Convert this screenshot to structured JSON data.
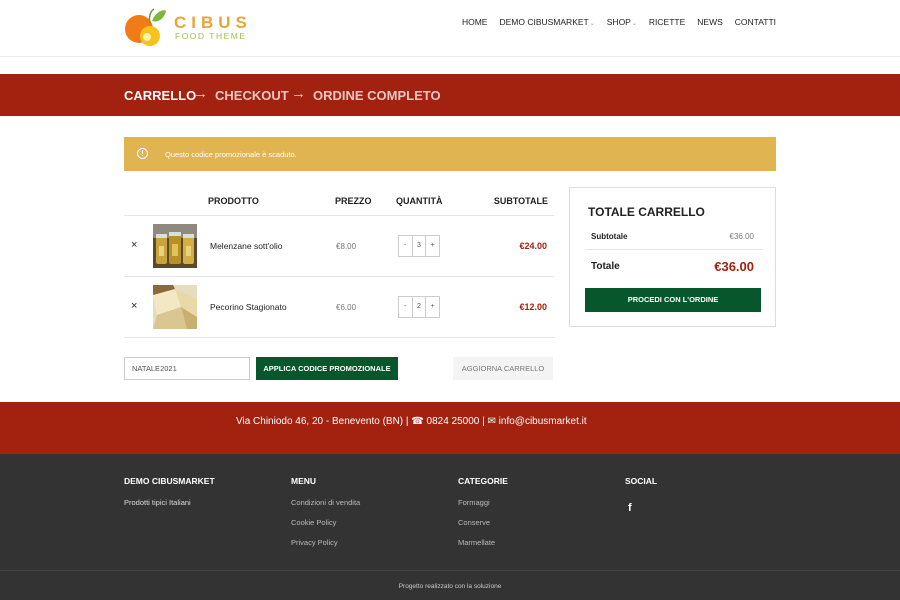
{
  "header": {
    "logo_text": "CIBUS",
    "logo_sub": "FOOD THEME",
    "nav": [
      {
        "label": "HOME"
      },
      {
        "label": "DEMO CIBUSMARKET",
        "has_caret": true
      },
      {
        "label": "SHOP",
        "has_caret": true
      },
      {
        "label": "RICETTE"
      },
      {
        "label": "NEWS"
      },
      {
        "label": "CONTATTI"
      }
    ]
  },
  "steps": {
    "cart": "CARRELLO",
    "checkout": "CHECKOUT",
    "complete": "ORDINE COMPLETO",
    "arrow": "→"
  },
  "notice": {
    "icon": "!",
    "text": "Questo codice promozionale è scaduto."
  },
  "cart": {
    "headers": {
      "product": "PRODOTTO",
      "price": "PREZZO",
      "quantity": "QUANTITÀ",
      "subtotal": "SUBTOTALE"
    },
    "items": [
      {
        "remove": "×",
        "name": "Melenzane sott'olio",
        "price": "€8.00",
        "qty": "3",
        "subtotal": "€24.00"
      },
      {
        "remove": "×",
        "name": "Pecorino Stagionato",
        "price": "€6.00",
        "qty": "2",
        "subtotal": "€12.00"
      }
    ],
    "qty_minus": "-",
    "qty_plus": "+",
    "coupon_value": "NATALE2021",
    "apply_coupon": "APPLICA CODICE PROMOZIONALE",
    "update_cart": "AGGIORNA CARRELLO"
  },
  "totals": {
    "title": "TOTALE CARRELLO",
    "subtotal_label": "Subtotale",
    "subtotal_value": "€36.00",
    "total_label": "Totale",
    "total_value": "€36.00",
    "checkout_button": "PROCEDI CON L'ORDINE"
  },
  "address_band": {
    "text": "Via Chiniodo 46, 20 - Benevento (BN) | ☎ 0824 25000 | ✉ info@cibusmarket.it"
  },
  "footer": {
    "col1": {
      "title": "DEMO CIBUSMARKET",
      "links": [
        "Prodotti tipici Italiani"
      ]
    },
    "col2": {
      "title": "MENU",
      "links": [
        "Condizioni di vendita",
        "Cookie Policy",
        "Privacy Policy"
      ]
    },
    "col3": {
      "title": "CATEGORIE",
      "links": [
        "Formaggi",
        "Conserve",
        "Marmellate"
      ]
    },
    "col4": {
      "title": "SOCIAL",
      "facebook": "f"
    },
    "credit": "Progetto realizzato con la soluzione"
  },
  "colors": {
    "brand_red": "#a2220f",
    "brand_green": "#08562b",
    "notice": "#e0b451",
    "footer": "#333333"
  }
}
